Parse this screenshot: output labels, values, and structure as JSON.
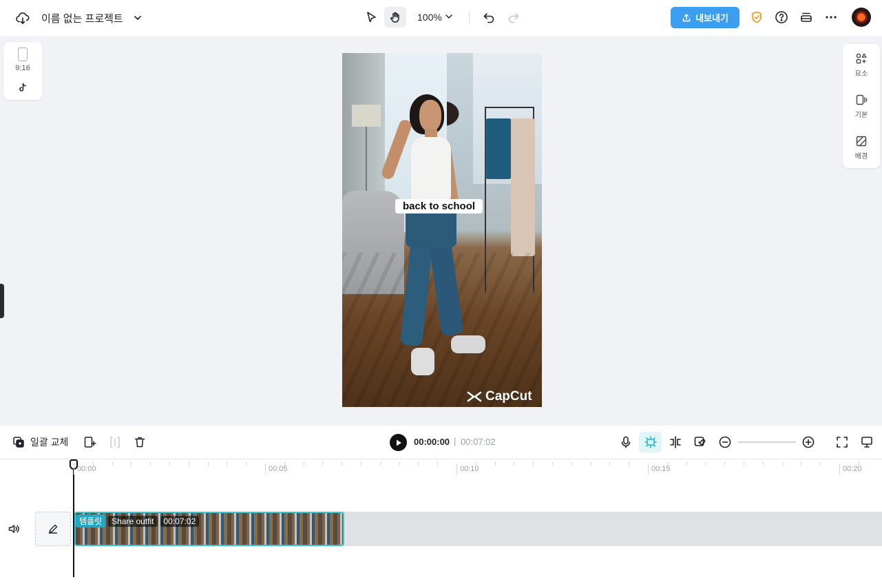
{
  "topbar": {
    "project_title": "이름 없는 프로젝트",
    "zoom": "100%",
    "export_label": "내보내기"
  },
  "left_panel": {
    "ratio": "9:16"
  },
  "right_panel": {
    "items": [
      {
        "label": "요소",
        "icon": "elements-icon"
      },
      {
        "label": "기본",
        "icon": "basic-icon"
      },
      {
        "label": "배경",
        "icon": "background-icon"
      }
    ]
  },
  "canvas": {
    "caption": "back to school",
    "watermark": "CapCut"
  },
  "timeline_toolbar": {
    "replace_all_label": "일괄 교체",
    "current_time": "00:00:00",
    "divider": "|",
    "total_time": "00:07:02",
    "zoom_level": 0
  },
  "ruler": {
    "labels": [
      "00:00",
      "00:05",
      "00:10",
      "00:15",
      "00:20"
    ]
  },
  "track": {
    "template_label": "템플릿",
    "clip_name": "Share outfit",
    "clip_duration": "00:07:02"
  },
  "colors": {
    "accent": "#3c9eef",
    "clip_border": "#34c7d5",
    "shield": "#f0a020"
  }
}
